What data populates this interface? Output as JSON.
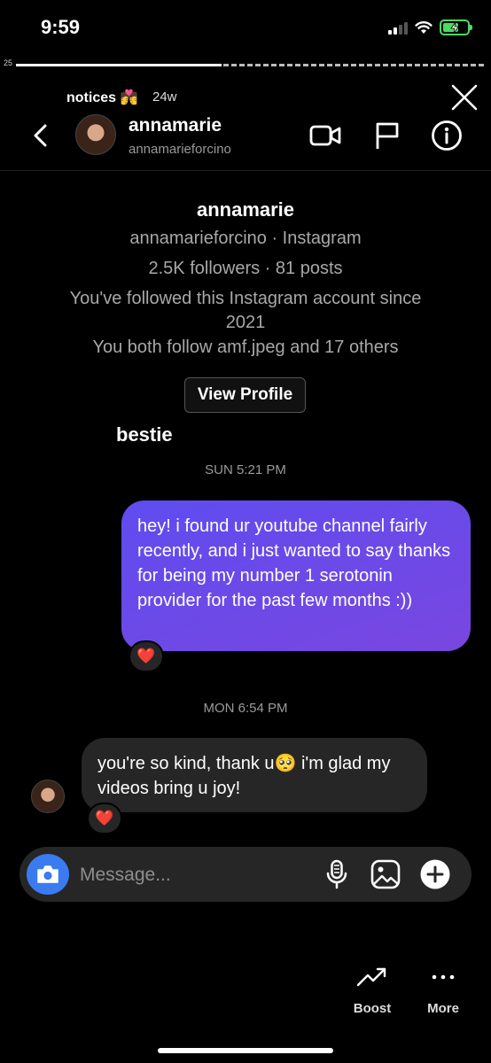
{
  "status_bar": {
    "time": "9:59"
  },
  "story": {
    "progress_label": "25",
    "progress_fraction": 0.44,
    "title": "notices 💏",
    "age": "24w"
  },
  "header": {
    "name": "annamarie",
    "username": "annamarieforcino"
  },
  "profile_card": {
    "name": "annamarie",
    "source": "annamarieforcino · Instagram",
    "stats": "2.5K followers · 81 posts",
    "followed_since": "You've followed this Instagram account since 2021",
    "mutuals": "You both follow amf.jpeg and 17 others",
    "view_profile_label": "View Profile"
  },
  "nickname": "bestie",
  "messages": [
    {
      "timestamp": "SUN 5:21 PM",
      "direction": "outgoing",
      "text": "hey! i found ur youtube channel fairly recently, and i just wanted to say thanks for being my number 1 serotonin provider for the past few months :))",
      "reaction": "❤️"
    },
    {
      "timestamp": "MON 6:54 PM",
      "direction": "incoming",
      "text": "you're so kind, thank u🥺 i'm glad my videos bring u joy!",
      "reaction": "❤️"
    }
  ],
  "composer": {
    "placeholder": "Message..."
  },
  "bottom_actions": [
    {
      "label": "Boost",
      "icon": "trending-up-icon"
    },
    {
      "label": "More",
      "icon": "more-dots-icon"
    }
  ],
  "colors": {
    "background": "#000000",
    "outgoing_bubble": "#6a4ae8",
    "incoming_bubble": "#262626",
    "camera_button": "#3a7bf0",
    "battery": "#4cd964"
  }
}
